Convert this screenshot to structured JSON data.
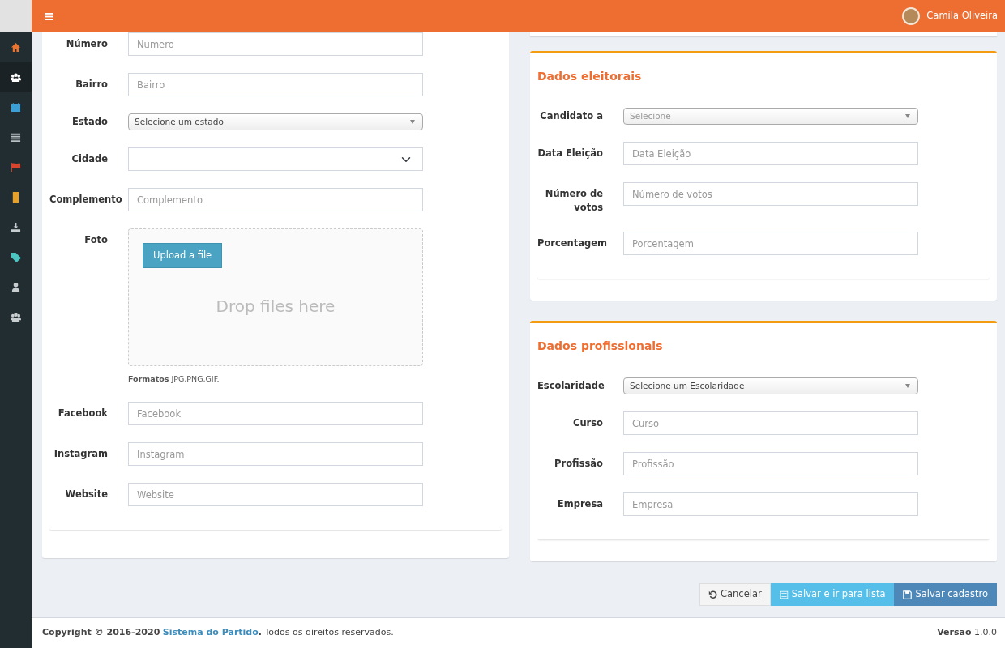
{
  "navbar": {
    "user": {
      "name": "Camila Oliveira"
    }
  },
  "sidebar": {
    "items": [
      {
        "selected": false,
        "color": "#e8742f"
      },
      {
        "selected": true,
        "color": "#ffffff"
      },
      {
        "selected": false,
        "color": "#3c9fd6"
      },
      {
        "selected": false,
        "color": "#b8c0c4"
      },
      {
        "selected": false,
        "color": "#d9442f"
      },
      {
        "selected": false,
        "color": "#e5a12a"
      },
      {
        "selected": false,
        "color": "#c8cdd0"
      },
      {
        "selected": false,
        "color": "#4cc4c0"
      },
      {
        "selected": false,
        "color": "#c8cdd0"
      },
      {
        "selected": false,
        "color": "#c8cdd0"
      }
    ]
  },
  "address_form": {
    "fields": [
      {
        "label": "Número",
        "kind": "text",
        "placeholder": "Numero"
      },
      {
        "label": "Bairro",
        "kind": "text",
        "placeholder": "Bairro"
      },
      {
        "label": "Estado",
        "kind": "select2",
        "value": "Selecione um estado"
      },
      {
        "label": "Cidade",
        "kind": "select"
      },
      {
        "label": "Complemento",
        "kind": "text",
        "placeholder": "Complemento"
      },
      {
        "label": "Foto",
        "kind": "upload",
        "button": "Upload a file",
        "drop_text": "Drop files here",
        "hint": "**Formatos** JPG,PNG,GIF."
      },
      {
        "label": "Facebook",
        "kind": "text",
        "placeholder": "Facebook"
      },
      {
        "label": "Instagram",
        "kind": "text",
        "placeholder": "Instagram"
      },
      {
        "label": "Website",
        "kind": "text",
        "placeholder": "Website"
      }
    ]
  },
  "electoral": {
    "title": "Dados eleitorais",
    "fields": [
      {
        "label": "Candidato a",
        "kind": "select2",
        "placeholder": "Selecione"
      },
      {
        "label": "Data Eleição",
        "kind": "text",
        "placeholder": "Data Eleição"
      },
      {
        "label": "Número de votos",
        "kind": "text",
        "placeholder": "Número de votos"
      },
      {
        "label": "Porcentagem",
        "kind": "text",
        "placeholder": "Porcentagem"
      }
    ]
  },
  "professional": {
    "title": "Dados profissionais",
    "fields": [
      {
        "label": "Escolaridade",
        "kind": "select2",
        "value": "Selecione um Escolaridade"
      },
      {
        "label": "Curso",
        "kind": "text",
        "placeholder": "Curso"
      },
      {
        "label": "Profissão",
        "kind": "text",
        "placeholder": "Profissão"
      },
      {
        "label": "Empresa",
        "kind": "text",
        "placeholder": "Empresa"
      }
    ]
  },
  "actions": [
    {
      "label": "Cancelar",
      "kind": "cancel"
    },
    {
      "label": "Salvar e ir para lista",
      "kind": "list"
    },
    {
      "label": "Salvar cadastro",
      "kind": "save"
    }
  ],
  "footer": {
    "copyright_start": "**Copyright © 2016-2020**",
    "link": "Sistema do Partido",
    "copyright_end": "**.** Todos os direitos reservados.",
    "version": "**Versão** 1.0.0"
  }
}
